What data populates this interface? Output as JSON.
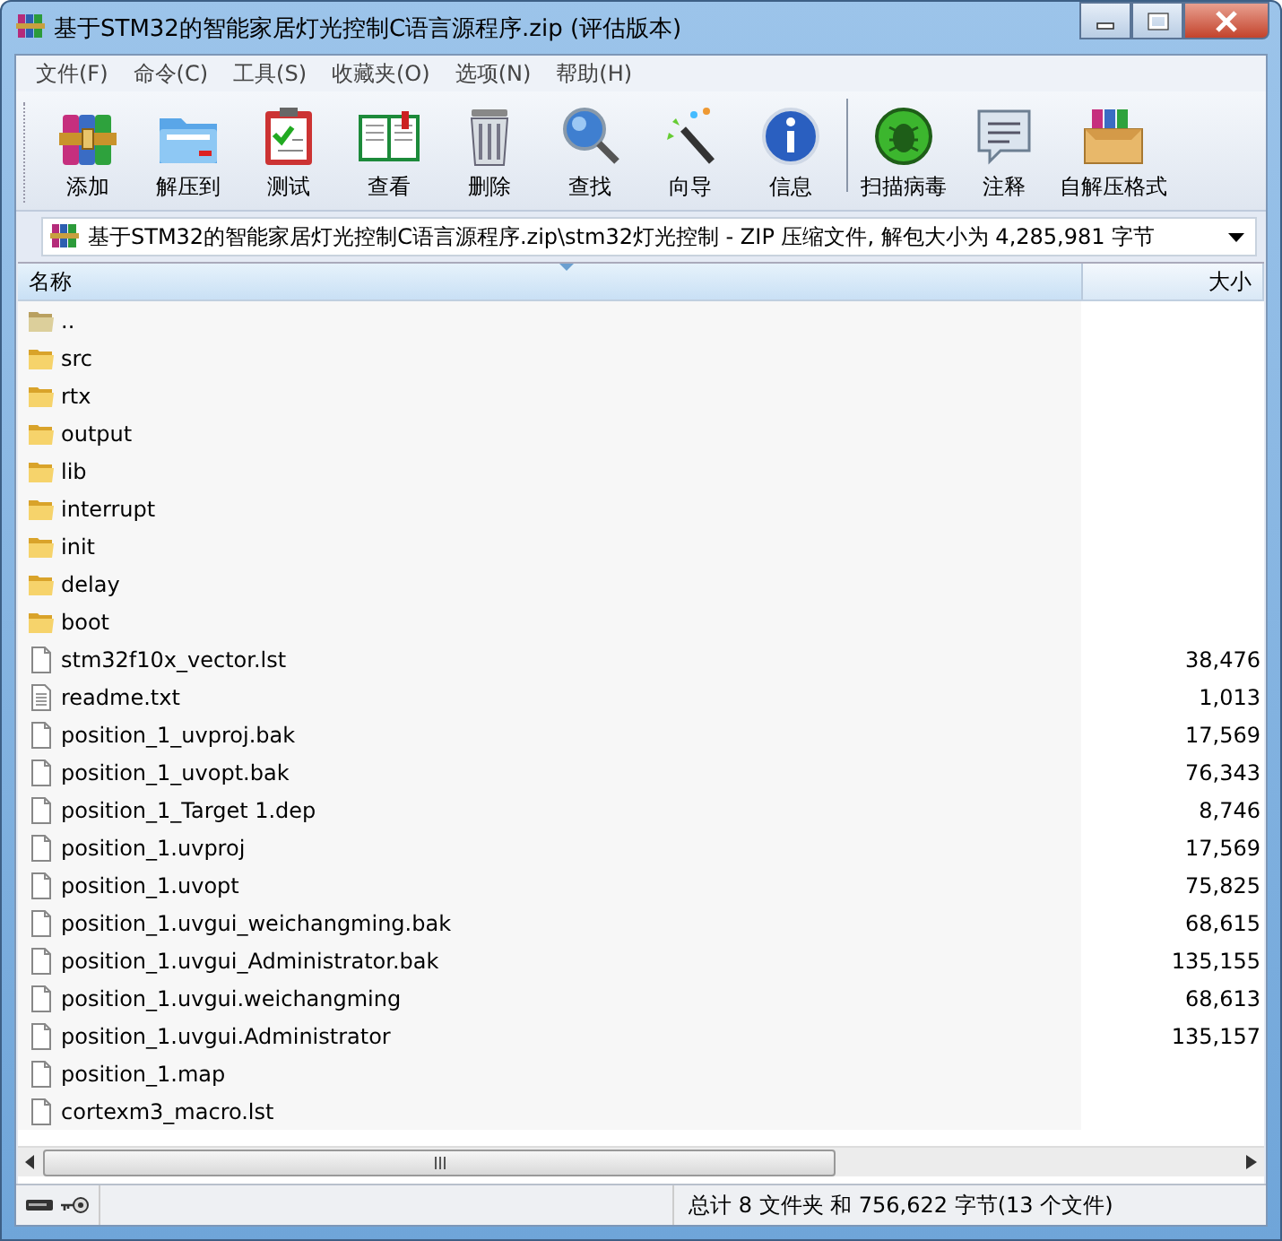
{
  "window": {
    "title": "基于STM32的智能家居灯光控制C语言源程序.zip (评估版本)"
  },
  "menu": [
    "文件(F)",
    "命令(C)",
    "工具(S)",
    "收藏夹(O)",
    "选项(N)",
    "帮助(H)"
  ],
  "toolbar": [
    {
      "label": "添加",
      "kind": "add"
    },
    {
      "label": "解压到",
      "kind": "extract"
    },
    {
      "label": "测试",
      "kind": "test"
    },
    {
      "label": "查看",
      "kind": "view"
    },
    {
      "label": "删除",
      "kind": "delete"
    },
    {
      "label": "查找",
      "kind": "find"
    },
    {
      "label": "向导",
      "kind": "wizard"
    },
    {
      "label": "信息",
      "kind": "info"
    },
    {
      "label": "扫描病毒",
      "kind": "scan"
    },
    {
      "label": "注释",
      "kind": "comment"
    },
    {
      "label": "自解压格式",
      "kind": "sfx"
    }
  ],
  "address": {
    "path": "基于STM32的智能家居灯光控制C语言源程序.zip\\stm32灯光控制 - ZIP 压缩文件, 解包大小为 4,285,981 字节"
  },
  "table": {
    "columns": [
      "名称",
      "大小"
    ],
    "rows": [
      {
        "name": "..",
        "kind": "parent"
      },
      {
        "name": "src",
        "kind": "folder"
      },
      {
        "name": "rtx",
        "kind": "folder"
      },
      {
        "name": "output",
        "kind": "folder"
      },
      {
        "name": "lib",
        "kind": "folder"
      },
      {
        "name": "interrupt",
        "kind": "folder"
      },
      {
        "name": "init",
        "kind": "folder"
      },
      {
        "name": "delay",
        "kind": "folder"
      },
      {
        "name": "boot",
        "kind": "folder"
      },
      {
        "name": "stm32f10x_vector.lst",
        "kind": "file",
        "size": "38,476"
      },
      {
        "name": "readme.txt",
        "kind": "text",
        "size": "1,013"
      },
      {
        "name": "position_1_uvproj.bak",
        "kind": "file",
        "size": "17,569"
      },
      {
        "name": "position_1_uvopt.bak",
        "kind": "file",
        "size": "76,343"
      },
      {
        "name": "position_1_Target 1.dep",
        "kind": "file",
        "size": "8,746"
      },
      {
        "name": "position_1.uvproj",
        "kind": "file",
        "size": "17,569"
      },
      {
        "name": "position_1.uvopt",
        "kind": "file",
        "size": "75,825"
      },
      {
        "name": "position_1.uvgui_weichangming.bak",
        "kind": "file",
        "size": "68,615"
      },
      {
        "name": "position_1.uvgui_Administrator.bak",
        "kind": "file",
        "size": "135,155"
      },
      {
        "name": "position_1.uvgui.weichangming",
        "kind": "file",
        "size": "68,613"
      },
      {
        "name": "position_1.uvgui.Administrator",
        "kind": "file",
        "size": "135,157"
      },
      {
        "name": "position_1.map",
        "kind": "file"
      },
      {
        "name": "cortexm3_macro.lst",
        "kind": "file"
      }
    ]
  },
  "status_bar": {
    "text": "总计 8 文件夹 和 756,622 字节(13 个文件)"
  }
}
